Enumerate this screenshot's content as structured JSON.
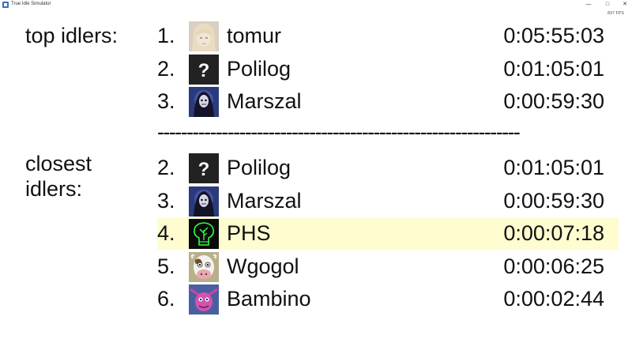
{
  "window": {
    "title": "True Idle Simulator",
    "controls": {
      "minimize": "—",
      "maximize": "□",
      "close": "✕"
    },
    "fps": "837 FPS"
  },
  "top": {
    "label": "top idlers:",
    "rows": [
      {
        "rank": "1.",
        "name": "tomur",
        "time": "0:05:55:03",
        "avatar": "anime-portrait-avatar"
      },
      {
        "rank": "2.",
        "name": "Polilog",
        "time": "0:01:05:01",
        "avatar": "question-mark-avatar"
      },
      {
        "rank": "3.",
        "name": "Marszal",
        "time": "0:00:59:30",
        "avatar": "hooded-figure-avatar"
      }
    ]
  },
  "divider": "--------------------------------------------------------------",
  "closest": {
    "label": "closest\nidlers:",
    "highlight_color": "#fffccf",
    "rows": [
      {
        "rank": "2.",
        "name": "Polilog",
        "time": "0:01:05:01",
        "avatar": "question-mark-avatar"
      },
      {
        "rank": "3.",
        "name": "Marszal",
        "time": "0:00:59:30",
        "avatar": "hooded-figure-avatar"
      },
      {
        "rank": "4.",
        "name": "PHS",
        "time": "0:00:07:18",
        "avatar": "neon-tree-avatar",
        "highlighted": true
      },
      {
        "rank": "5.",
        "name": "Wgogol",
        "time": "0:00:06:25",
        "avatar": "cow-cartoon-avatar"
      },
      {
        "rank": "6.",
        "name": "Bambino",
        "time": "0:00:02:44",
        "avatar": "pink-creature-avatar"
      }
    ]
  }
}
